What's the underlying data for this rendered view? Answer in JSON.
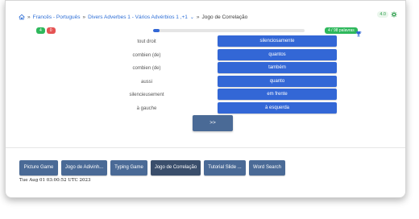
{
  "breadcrumb": {
    "items": [
      "Francês - Português",
      "Divers Adverbes 1 - Vários Advérbios 1 ,+1",
      "Jogo de Correlação"
    ]
  },
  "score": {
    "value": "4.0"
  },
  "stats": {
    "correct": "4",
    "wrong": "0",
    "words": "4 / 98 palavras",
    "progress": 0.04
  },
  "pairs": {
    "left": [
      "tout droit",
      "combien (de)",
      "combien (de)",
      "aussi",
      "silencieusement",
      "à gauche"
    ],
    "right": [
      "silenciosamente",
      "quantos",
      "também",
      "quanto",
      "em frente",
      "à esquerda"
    ]
  },
  "next_label": ">>",
  "tabs": [
    "Picture Game",
    "Jogo de Adivinh...",
    "Typing Game",
    "Jogo de Correlação",
    "Tutorial Slide ...",
    "Word Search"
  ],
  "active_tab": "Jogo de Correlação",
  "timestamp": "Tue Aug 01 03:00:52 UTC 2023",
  "colors": {
    "accent": "#3367d6",
    "tab": "#4a6a96",
    "success": "#2eb85c",
    "danger": "#e55353"
  }
}
